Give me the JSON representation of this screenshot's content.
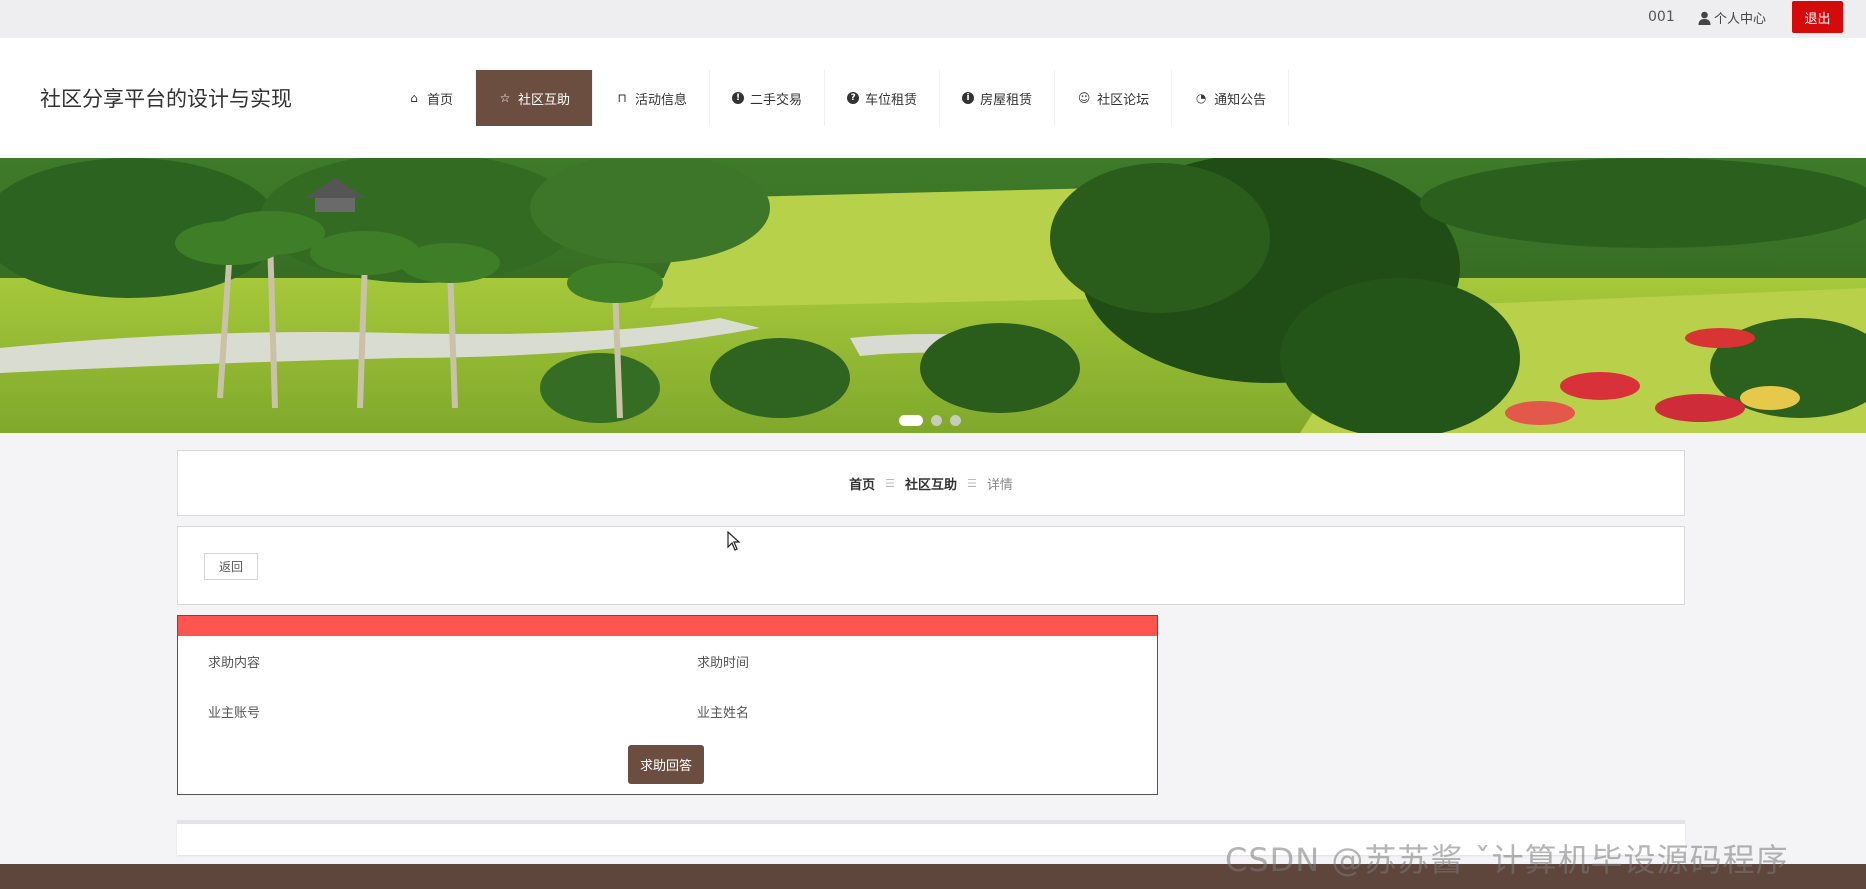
{
  "topbar": {
    "user_id": "001",
    "personal_center": "个人中心",
    "logout": "退出"
  },
  "header": {
    "brand": "社区分享平台的设计与实现",
    "nav": [
      {
        "label": "首页",
        "icon": "home-icon"
      },
      {
        "label": "社区互助",
        "icon": "star-icon",
        "active": true
      },
      {
        "label": "活动信息",
        "icon": "bag-icon"
      },
      {
        "label": "二手交易",
        "icon": "exclamation-circle-icon"
      },
      {
        "label": "车位租赁",
        "icon": "question-circle-icon"
      },
      {
        "label": "房屋租赁",
        "icon": "info-circle-icon"
      },
      {
        "label": "社区论坛",
        "icon": "smile-icon"
      },
      {
        "label": "通知公告",
        "icon": "clock-icon"
      }
    ]
  },
  "banner": {
    "slides": 3,
    "active_slide": 1
  },
  "breadcrumb": {
    "home": "首页",
    "section": "社区互助",
    "current": "详情"
  },
  "actions": {
    "back": "返回"
  },
  "detail": {
    "fields": {
      "content_label": "求助内容",
      "time_label": "求助时间",
      "account_label": "业主账号",
      "name_label": "业主姓名"
    },
    "answer_button": "求助回答"
  },
  "colors": {
    "brand_brown": "#6b4e40",
    "logout_red": "#d40b0b",
    "detail_strip": "#fe5551",
    "footer": "#5e463c"
  },
  "watermark": "CSDN @苏苏酱   ˇ计算机毕设源码程序"
}
